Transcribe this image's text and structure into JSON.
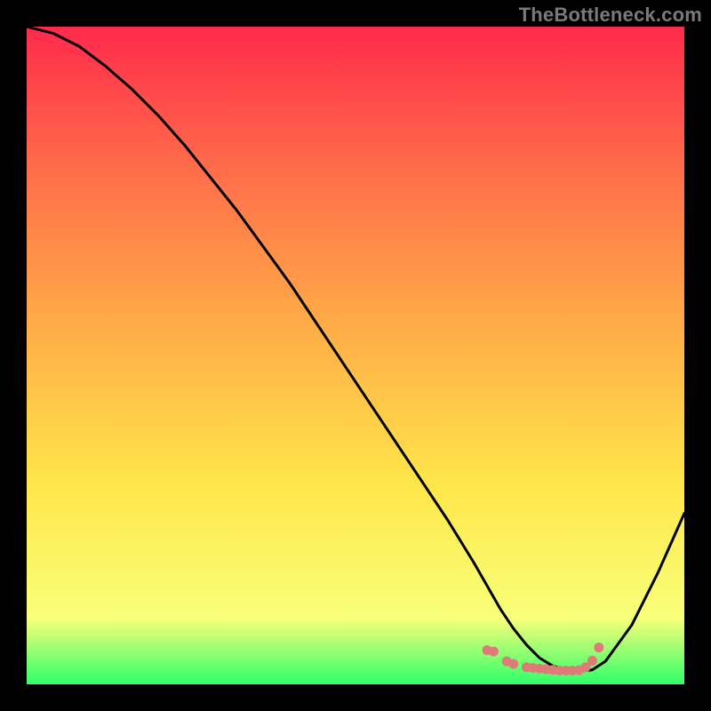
{
  "watermark": "TheBottleneck.com",
  "colors": {
    "black": "#000000",
    "curve": "#000000",
    "marker": "#e07a78",
    "gradient_top": "#ff2a4b",
    "gradient_mid1": "#ff6e4a",
    "gradient_mid2": "#ffb347",
    "gradient_mid3": "#ffe74a",
    "gradient_low": "#f8ff7a",
    "gradient_bottom": "#2fff6a"
  },
  "chart_data": {
    "type": "line",
    "title": "",
    "xlabel": "",
    "ylabel": "",
    "xlim": [
      0,
      100
    ],
    "ylim": [
      0,
      100
    ],
    "x": [
      0,
      4,
      8,
      12,
      16,
      20,
      24,
      28,
      32,
      36,
      40,
      44,
      48,
      52,
      56,
      60,
      64,
      68,
      70,
      72,
      74,
      76,
      78,
      80,
      82,
      84,
      86,
      88,
      92,
      96,
      100
    ],
    "values": [
      100,
      99,
      97,
      94,
      90.5,
      86.5,
      82,
      77,
      72,
      66.5,
      61,
      55,
      49,
      43,
      37,
      31,
      25,
      18.5,
      15,
      11.5,
      8.5,
      6,
      4,
      2.8,
      2.2,
      2.0,
      2.2,
      3.5,
      9,
      17,
      26
    ],
    "flat_region": {
      "x_start": 70,
      "x_end": 87,
      "marker_x": [
        70,
        71,
        73,
        74,
        76,
        77,
        78,
        79,
        80,
        81,
        82,
        83,
        84,
        85,
        86,
        87
      ],
      "marker_y": [
        5.2,
        5.0,
        3.5,
        3.1,
        2.6,
        2.5,
        2.4,
        2.3,
        2.2,
        2.1,
        2.1,
        2.1,
        2.15,
        2.6,
        3.6,
        5.6
      ]
    }
  }
}
